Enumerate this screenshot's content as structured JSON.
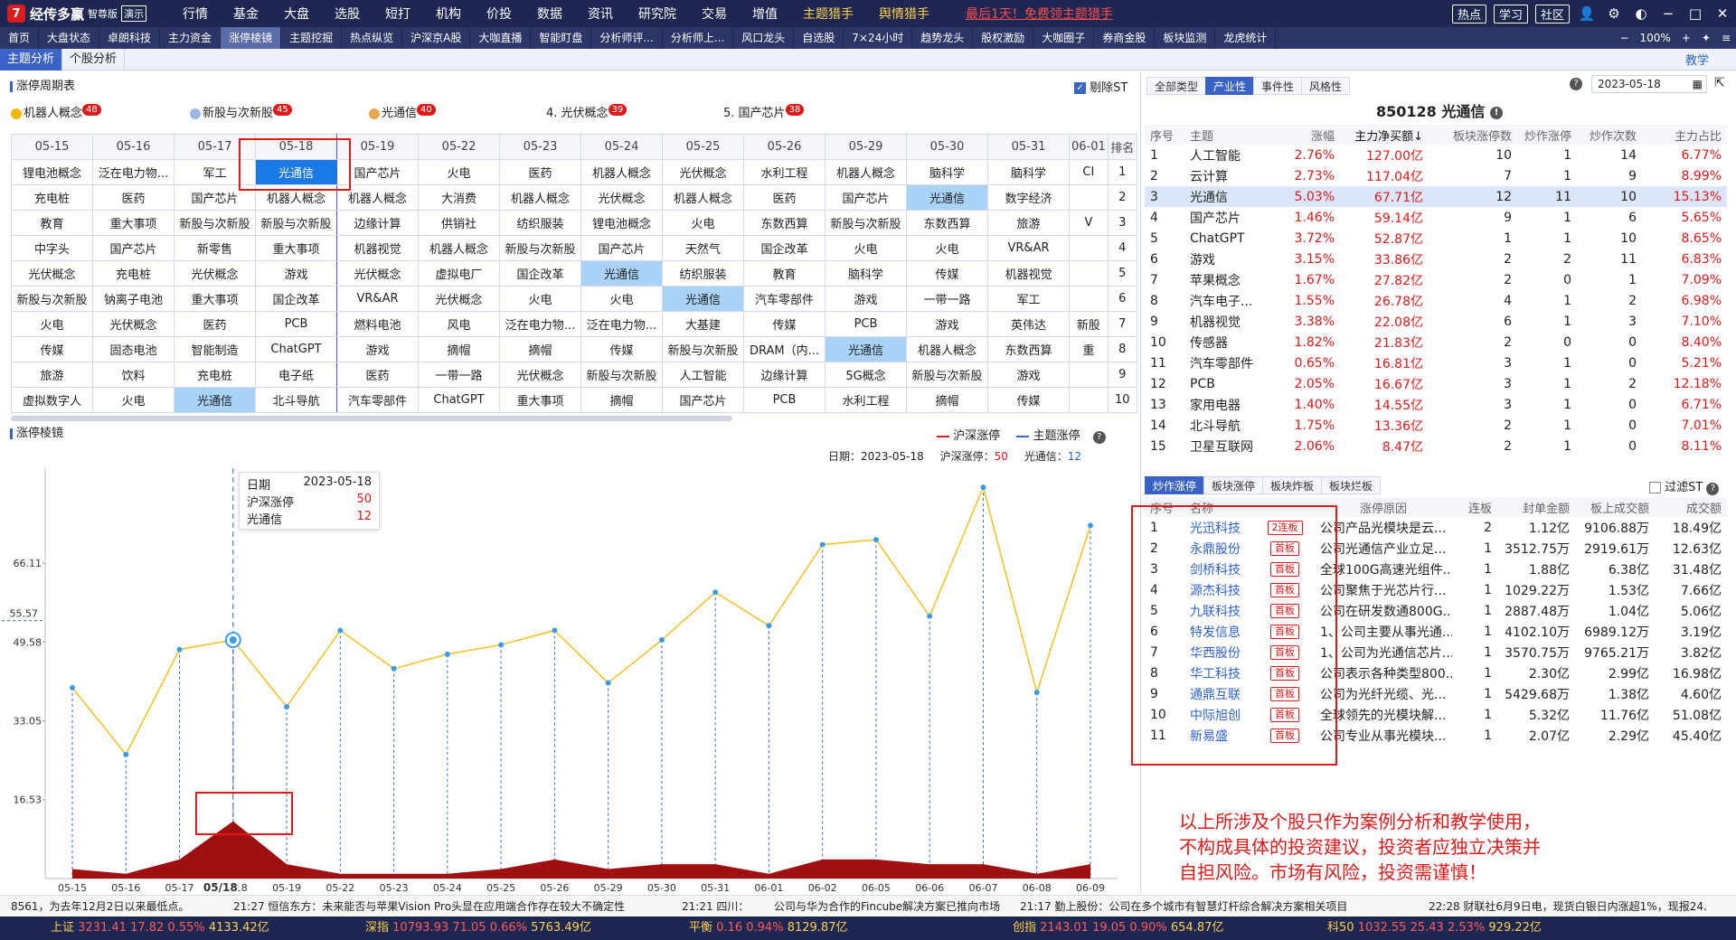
{
  "topbar": {
    "app_name": "经传多赢",
    "edition": "智尊版",
    "demo": "演示",
    "menu": [
      "行情",
      "基金",
      "大盘",
      "选股",
      "短打",
      "机构",
      "价投",
      "数据",
      "资讯",
      "研究院",
      "交易",
      "增值",
      "主题猎手",
      "舆情猎手"
    ],
    "promo": "最后1天！免费领主题猎手",
    "right_pills": [
      "热点",
      "学习",
      "社区"
    ]
  },
  "tabs": [
    "首页",
    "大盘状态",
    "卓朗科技",
    "主力资金",
    "涨停棱镜",
    "主题挖掘",
    "热点纵览",
    "沪深京A股",
    "大咖直播",
    "智能盯盘",
    "分析师评...",
    "分析师上...",
    "风口龙头",
    "自选股",
    "7×24小时",
    "趋势龙头",
    "股权激励",
    "大咖圈子",
    "券商金股",
    "板块监测",
    "龙虎统计"
  ],
  "tabs_right": {
    "zoom": "100%"
  },
  "subtabs": [
    "主题分析",
    "个股分析"
  ],
  "learn_link": "教学",
  "cycle": {
    "title": "涨停周期表",
    "filter_st": "剔除ST",
    "top_themes": [
      {
        "name": "机器人概念",
        "count": "48"
      },
      {
        "name": "新股与次新股",
        "count": "45"
      },
      {
        "name": "光通信",
        "count": "40"
      },
      {
        "name": "4. 光伏概念",
        "count": "39"
      },
      {
        "name": "5. 国产芯片",
        "count": "38"
      }
    ],
    "dates": [
      "05-15",
      "05-16",
      "05-17",
      "05-18",
      "05-19",
      "05-22",
      "05-23",
      "05-24",
      "05-25",
      "05-26",
      "05-29",
      "05-30",
      "05-31",
      "06-01"
    ],
    "rank_header": "排名",
    "rows": [
      [
        "锂电池概念",
        "泛在电力物...",
        "军工",
        "光通信",
        "国产芯片",
        "火电",
        "医药",
        "机器人概念",
        "光伏概念",
        "水利工程",
        "机器人概念",
        "脑科学",
        "脑科学",
        "CI",
        "1"
      ],
      [
        "充电桩",
        "医药",
        "国产芯片",
        "机器人概念",
        "机器人概念",
        "大消费",
        "机器人概念",
        "光伏概念",
        "机器人概念",
        "医药",
        "国产芯片",
        "光通信",
        "数字经济",
        "",
        "2"
      ],
      [
        "教育",
        "重大事项",
        "新股与次新股",
        "新股与次新股",
        "边缘计算",
        "供销社",
        "纺织服装",
        "锂电池概念",
        "火电",
        "东数西算",
        "新股与次新股",
        "东数西算",
        "旅游",
        "V",
        "3"
      ],
      [
        "中字头",
        "国产芯片",
        "新零售",
        "重大事项",
        "机器视觉",
        "机器人概念",
        "新股与次新股",
        "国产芯片",
        "天然气",
        "国企改革",
        "火电",
        "火电",
        "VR&AR",
        "",
        "4"
      ],
      [
        "光伏概念",
        "充电桩",
        "光伏概念",
        "游戏",
        "光伏概念",
        "虚拟电厂",
        "国企改革",
        "光通信",
        "纺织服装",
        "教育",
        "脑科学",
        "传媒",
        "机器视觉",
        "",
        "5"
      ],
      [
        "新股与次新股",
        "钠离子电池",
        "重大事项",
        "国企改革",
        "VR&AR",
        "光伏概念",
        "火电",
        "火电",
        "光通信",
        "汽车零部件",
        "游戏",
        "一带一路",
        "军工",
        "",
        "6"
      ],
      [
        "火电",
        "光伏概念",
        "医药",
        "PCB",
        "燃料电池",
        "风电",
        "泛在电力物...",
        "泛在电力物...",
        "大基建",
        "传媒",
        "PCB",
        "游戏",
        "英伟达",
        "新股",
        "7"
      ],
      [
        "传媒",
        "固态电池",
        "智能制造",
        "ChatGPT",
        "游戏",
        "摘帽",
        "摘帽",
        "传媒",
        "新股与次新股",
        "DRAM（内...",
        "光通信",
        "机器人概念",
        "东数西算",
        "重",
        "8"
      ],
      [
        "旅游",
        "饮料",
        "充电桩",
        "电子纸",
        "医药",
        "一带一路",
        "光伏概念",
        "新股与次新股",
        "人工智能",
        "边缘计算",
        "5G概念",
        "新股与次新股",
        "游戏",
        "",
        "9"
      ],
      [
        "虚拟数字人",
        "火电",
        "光通信",
        "北斗导航",
        "汽车零部件",
        "ChatGPT",
        "重大事项",
        "摘帽",
        "国产芯片",
        "PCB",
        "水利工程",
        "摘帽",
        "传媒",
        "",
        "10"
      ]
    ]
  },
  "prism": {
    "title": "涨停棱镜",
    "legend": [
      "沪深涨停",
      "主题涨停"
    ],
    "info_date_label": "日期：",
    "info_date": "2023-05-18",
    "info_hs_label": "沪深涨停：",
    "info_hs": "50",
    "info_theme_label": "光通信：",
    "info_theme": "12",
    "tooltip": {
      "date_label": "日期",
      "date": "2023-05-18",
      "hs_label": "沪深涨停",
      "hs": "50",
      "theme_label": "光通信",
      "theme": "12"
    },
    "crosshair_value": "55.57"
  },
  "chart_data": {
    "type": "line",
    "x": [
      "05-15",
      "05-16",
      "05-17",
      "05-18",
      "05-19",
      "05-22",
      "05-23",
      "05-24",
      "05-25",
      "05-26",
      "05-29",
      "05-30",
      "05-31",
      "06-01",
      "06-02",
      "06-05",
      "06-06",
      "06-07",
      "06-08",
      "06-09"
    ],
    "x_selected_label": "05/18",
    "y_ticks": [
      "66.11",
      "49.58",
      "33.05",
      "16.53"
    ],
    "series": [
      {
        "name": "主题涨停",
        "color": "#f0c020",
        "values": [
          40,
          26,
          48,
          50,
          36,
          52,
          44,
          47,
          49,
          52,
          41,
          50,
          60,
          53,
          70,
          71,
          55,
          82,
          39,
          74
        ]
      },
      {
        "name": "沪深涨停",
        "color": "#a01010",
        "values": [
          2,
          1,
          4,
          12,
          3,
          1,
          1,
          1,
          2,
          4,
          2,
          3,
          3,
          1,
          4,
          4,
          3,
          3,
          1,
          3
        ]
      }
    ]
  },
  "right": {
    "filter_tabs": [
      "全部类型",
      "产业性",
      "事件性",
      "风格性"
    ],
    "date": "2023-05-18",
    "stock_title": "850128 光通信",
    "theme_headers": [
      "序号",
      "主题",
      "涨幅",
      "主力净买额↓",
      "板块涨停数",
      "炒作涨停",
      "炒作次数",
      "主力占比"
    ],
    "themes": [
      [
        "1",
        "人工智能",
        "2.76%",
        "127.00亿",
        "10",
        "1",
        "14",
        "6.77%"
      ],
      [
        "2",
        "云计算",
        "2.73%",
        "117.04亿",
        "7",
        "1",
        "9",
        "8.99%"
      ],
      [
        "3",
        "光通信",
        "5.03%",
        "67.71亿",
        "12",
        "11",
        "10",
        "15.13%"
      ],
      [
        "4",
        "国产芯片",
        "1.46%",
        "59.14亿",
        "9",
        "1",
        "6",
        "5.65%"
      ],
      [
        "5",
        "ChatGPT",
        "3.72%",
        "52.87亿",
        "1",
        "1",
        "10",
        "8.65%"
      ],
      [
        "6",
        "游戏",
        "3.15%",
        "33.86亿",
        "2",
        "2",
        "11",
        "6.83%"
      ],
      [
        "7",
        "苹果概念",
        "1.67%",
        "27.82亿",
        "2",
        "0",
        "1",
        "7.09%"
      ],
      [
        "8",
        "汽车电子...",
        "1.55%",
        "26.78亿",
        "4",
        "1",
        "2",
        "6.98%"
      ],
      [
        "9",
        "机器视觉",
        "3.38%",
        "22.08亿",
        "6",
        "1",
        "3",
        "7.10%"
      ],
      [
        "10",
        "传感器",
        "1.82%",
        "21.83亿",
        "2",
        "0",
        "0",
        "8.40%"
      ],
      [
        "11",
        "汽车零部件",
        "0.65%",
        "16.81亿",
        "3",
        "1",
        "0",
        "5.21%"
      ],
      [
        "12",
        "PCB",
        "2.05%",
        "16.67亿",
        "3",
        "1",
        "2",
        "12.18%"
      ],
      [
        "13",
        "家用电器",
        "1.40%",
        "14.55亿",
        "3",
        "1",
        "0",
        "6.71%"
      ],
      [
        "14",
        "北斗导航",
        "1.75%",
        "13.36亿",
        "2",
        "1",
        "0",
        "7.01%"
      ],
      [
        "15",
        "卫星互联网",
        "2.06%",
        "8.47亿",
        "2",
        "1",
        "0",
        "8.11%"
      ]
    ],
    "stock_tabs": [
      "炒作涨停",
      "板块涨停",
      "板块炸板",
      "板块烂板"
    ],
    "filter_st": "过滤ST",
    "stock_headers": [
      "序号",
      "名称",
      "",
      "涨停原因",
      "连板",
      "封单金额",
      "板上成交额",
      "成交额"
    ],
    "stocks": [
      [
        "1",
        "光迅科技",
        "2连板",
        "公司产品光模块是云...",
        "2",
        "1.12亿",
        "9106.88万",
        "18.49亿"
      ],
      [
        "2",
        "永鼎股份",
        "首板",
        "公司光通信产业立足...",
        "1",
        "3512.75万",
        "2919.61万",
        "12.63亿"
      ],
      [
        "3",
        "剑桥科技",
        "首板",
        "全球100G高速光组件...",
        "1",
        "1.88亿",
        "6.38亿",
        "31.48亿"
      ],
      [
        "4",
        "源杰科技",
        "首板",
        "公司聚焦于光芯片行...",
        "1",
        "1029.22万",
        "1.53亿",
        "7.66亿"
      ],
      [
        "5",
        "九联科技",
        "首板",
        "公司在研发数通800G...",
        "1",
        "2887.48万",
        "1.04亿",
        "5.06亿"
      ],
      [
        "6",
        "特发信息",
        "首板",
        "1、公司主要从事光通...",
        "1",
        "4102.10万",
        "6989.12万",
        "3.19亿"
      ],
      [
        "7",
        "华西股份",
        "首板",
        "1、公司为光通信芯片...",
        "1",
        "3570.75万",
        "9765.21万",
        "3.82亿"
      ],
      [
        "8",
        "华工科技",
        "首板",
        "公司表示各种类型800...",
        "1",
        "2.30亿",
        "2.99亿",
        "16.98亿"
      ],
      [
        "9",
        "通鼎互联",
        "首板",
        "公司为光纤光缆、光...",
        "1",
        "5429.68万",
        "1.38亿",
        "4.60亿"
      ],
      [
        "10",
        "中际旭创",
        "首板",
        "全球领先的光模块解...",
        "1",
        "5.32亿",
        "11.76亿",
        "51.08亿"
      ],
      [
        "11",
        "新易盛",
        "首板",
        "公司专业从事光模块...",
        "1",
        "2.07亿",
        "2.29亿",
        "45.40亿"
      ]
    ],
    "disclaimer": [
      "以上所涉及个股只作为案例分析和教学使用，",
      "不构成具体的投资建议，投资者应独立决策并",
      "自担风险。市场有风险，投资需谨慎！"
    ]
  },
  "news": [
    "8561，为去年12月2日以来最低点。",
    "21:27 恒信东方：未来能否与苹果Vision Pro头显在应用端合作存在较大不确定性",
    "21:21 四川：",
    "公司与华为合作的Fincube解决方案已推向市场",
    "21:17 勤上股份：公司在多个城市有智慧灯杆综合解决方案相关项目",
    "22:28 财联社6月9日电，现货白银日内涨超1%，现报24."
  ],
  "indices": [
    {
      "name": "上证",
      "value": "3231.41",
      "chg": "17.82",
      "pct": "0.55%",
      "amt": "4133.42亿"
    },
    {
      "name": "深指",
      "value": "10793.93",
      "chg": "71.05",
      "pct": "0.66%",
      "amt": "5763.49亿"
    },
    {
      "name": "平衡",
      "value": "",
      "chg": "0.16",
      "pct": "0.94%",
      "amt": "8129.87亿"
    },
    {
      "name": "创指",
      "value": "2143.01",
      "chg": "19.05",
      "pct": "0.90%",
      "amt": "654.87亿"
    },
    {
      "name": "科50",
      "value": "1032.55",
      "chg": "25.43",
      "pct": "2.53%",
      "amt": "929.22亿"
    }
  ]
}
